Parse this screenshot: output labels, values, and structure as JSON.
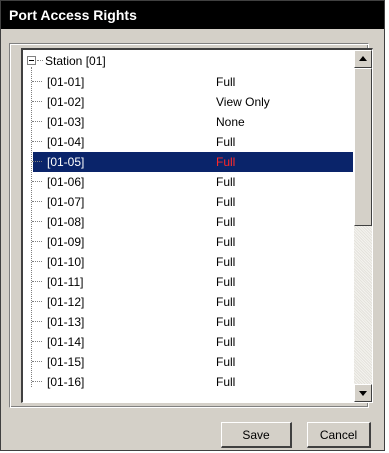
{
  "window": {
    "title": "Port Access Rights"
  },
  "tree": {
    "root_label": "Station [01]",
    "rows": [
      {
        "port": "[01-01]",
        "right": "Full"
      },
      {
        "port": "[01-02]",
        "right": "View Only"
      },
      {
        "port": "[01-03]",
        "right": "None"
      },
      {
        "port": "[01-04]",
        "right": "Full"
      },
      {
        "port": "[01-05]",
        "right": "Full",
        "selected": true
      },
      {
        "port": "[01-06]",
        "right": "Full"
      },
      {
        "port": "[01-07]",
        "right": "Full"
      },
      {
        "port": "[01-08]",
        "right": "Full"
      },
      {
        "port": "[01-09]",
        "right": "Full"
      },
      {
        "port": "[01-10]",
        "right": "Full"
      },
      {
        "port": "[01-11]",
        "right": "Full"
      },
      {
        "port": "[01-12]",
        "right": "Full"
      },
      {
        "port": "[01-13]",
        "right": "Full"
      },
      {
        "port": "[01-14]",
        "right": "Full"
      },
      {
        "port": "[01-15]",
        "right": "Full"
      },
      {
        "port": "[01-16]",
        "right": "Full"
      }
    ]
  },
  "buttons": {
    "save": "Save",
    "cancel": "Cancel"
  },
  "colors": {
    "selection_bg": "#0a246a",
    "selection_text": "#ffffff",
    "selected_right": "#ff2a2a"
  }
}
